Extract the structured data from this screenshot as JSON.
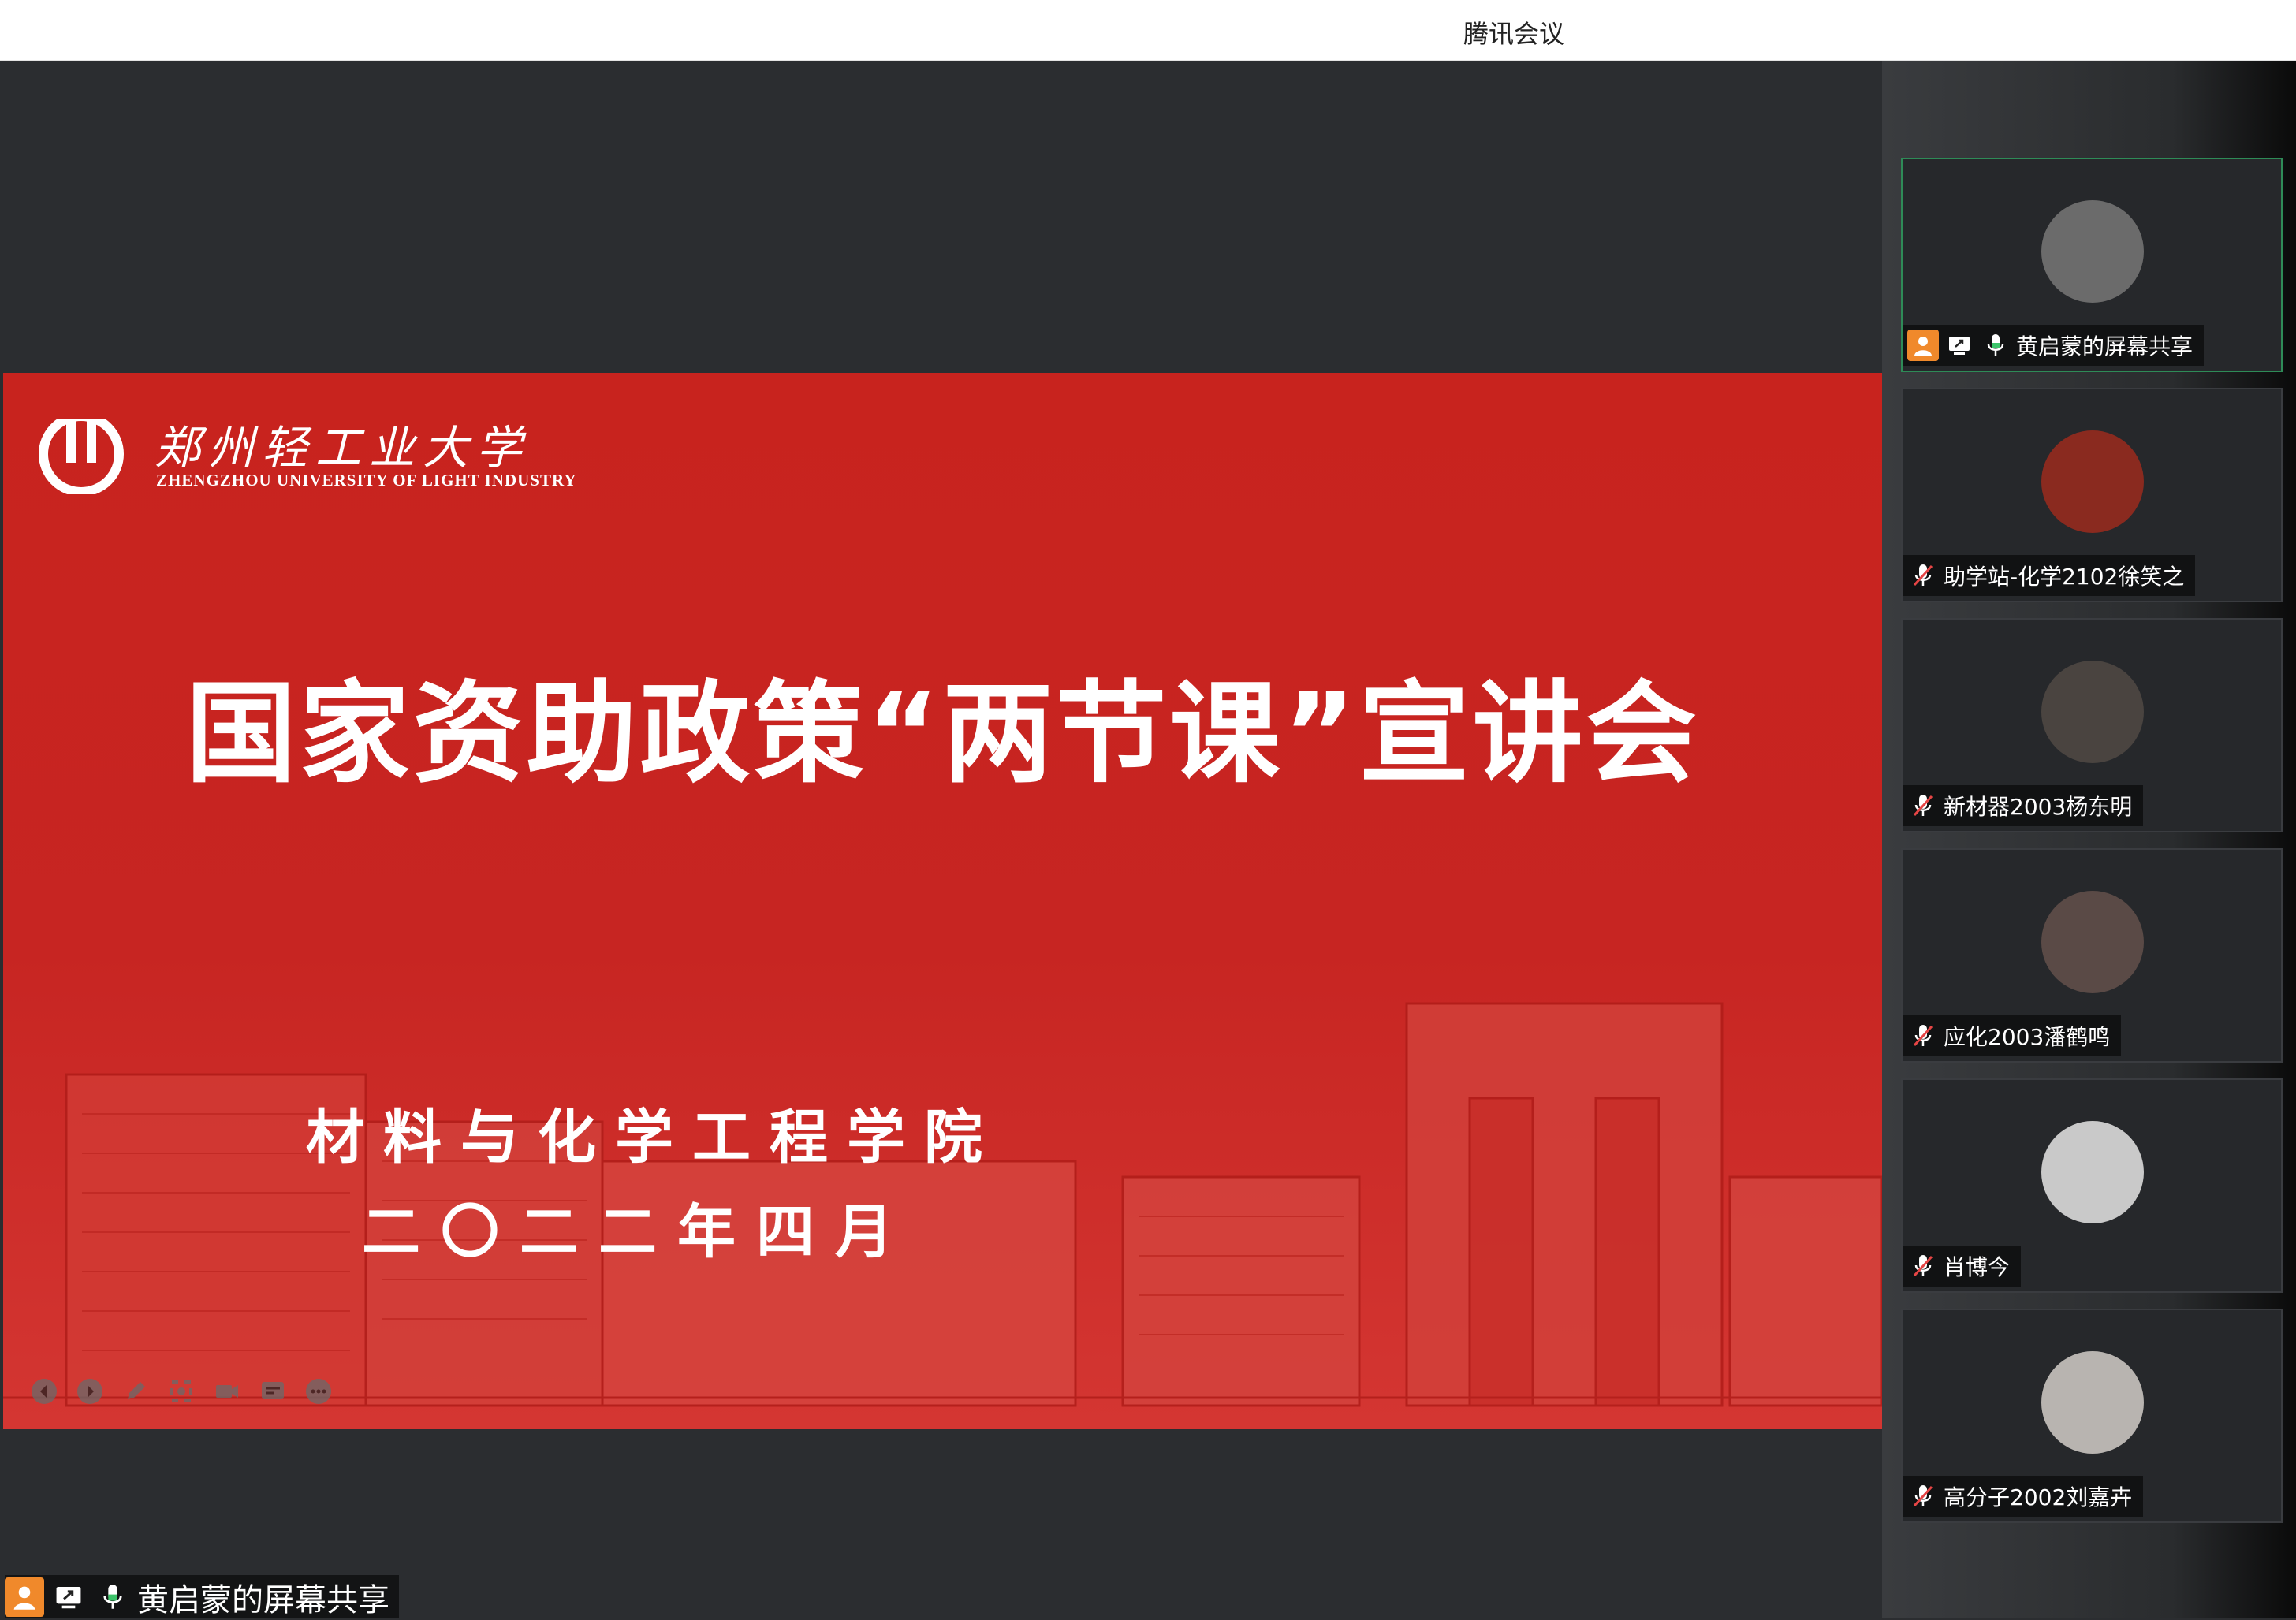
{
  "window": {
    "title": "腾讯会议"
  },
  "slide": {
    "university_cn": "郑州轻工业大学",
    "university_en": "ZHENGZHOU UNIVERSITY OF LIGHT INDUSTRY",
    "title": "国家资助政策“两节课”宣讲会",
    "subtitle_school": "材料与化学工程学院",
    "subtitle_date": "二〇二二年四月",
    "colors": {
      "background": "#c8231e",
      "text": "#ffffff"
    }
  },
  "presentation_controls": [
    {
      "name": "previous-icon"
    },
    {
      "name": "next-icon"
    },
    {
      "name": "pen-icon"
    },
    {
      "name": "zoom-icon"
    },
    {
      "name": "camera-icon"
    },
    {
      "name": "subtitles-icon"
    },
    {
      "name": "more-icon"
    }
  ],
  "participants": [
    {
      "name": "黄启蒙的屏幕共享",
      "muted": false,
      "sharing": true,
      "active": true,
      "avatar_color": "#6b6b6b"
    },
    {
      "name": "助学站-化学2102徐笑之",
      "muted": true,
      "sharing": false,
      "active": false,
      "avatar_color": "#8a2a1f"
    },
    {
      "name": "新材器2003杨东明",
      "muted": true,
      "sharing": false,
      "active": false,
      "avatar_color": "#4a4440"
    },
    {
      "name": "应化2003潘鹤鸣",
      "muted": true,
      "sharing": false,
      "active": false,
      "avatar_color": "#5a4a46"
    },
    {
      "name": "肖博今",
      "muted": true,
      "sharing": false,
      "active": false,
      "avatar_color": "#c9c9c9"
    },
    {
      "name": "高分子2002刘嘉卉",
      "muted": true,
      "sharing": false,
      "active": false,
      "avatar_color": "#b8b4b0"
    }
  ],
  "share_label": "黄启蒙的屏幕共享",
  "colors": {
    "accent": "#f0892b",
    "active_border": "#2e8b57",
    "mic_on": "#3cc46a"
  }
}
